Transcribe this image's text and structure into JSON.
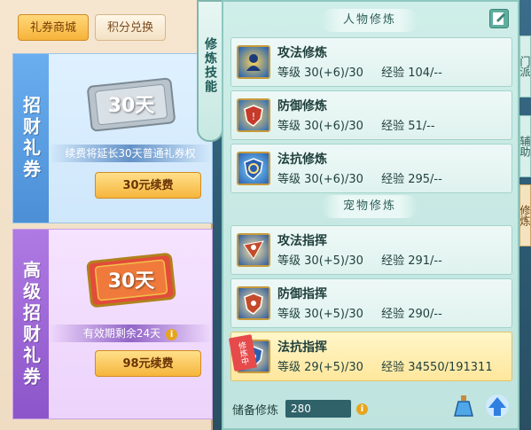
{
  "shop": {
    "tabs": [
      {
        "label": "礼券商城",
        "active": true
      },
      {
        "label": "积分兑换",
        "active": false
      }
    ],
    "basic_card": {
      "side_title": "招财礼券",
      "ticket_text": "30天",
      "note": "续费将延长30天普通礼券权",
      "button": "30元续费"
    },
    "premium_card": {
      "side_title": "高级招财礼券",
      "ticket_text": "30天",
      "note": "有效期剩余24天",
      "info": "i",
      "button": "98元续费"
    }
  },
  "skill_tab": {
    "label": "修炼技能"
  },
  "cultivation": {
    "character_section": "人物修炼",
    "pet_section": "宠物修炼",
    "level_label": "等级",
    "exp_label": "经验",
    "character_skills": [
      {
        "name": "攻法修炼",
        "level": "30(+6)/30",
        "exp": "104/--",
        "icon": "attack-magic-icon"
      },
      {
        "name": "防御修炼",
        "level": "30(+6)/30",
        "exp": "51/--",
        "icon": "defense-icon"
      },
      {
        "name": "法抗修炼",
        "level": "30(+6)/30",
        "exp": "295/--",
        "icon": "magic-resist-icon"
      }
    ],
    "pet_skills": [
      {
        "name": "攻法指挥",
        "level": "30(+5)/30",
        "exp": "291/--",
        "icon": "pet-attack-icon"
      },
      {
        "name": "防御指挥",
        "level": "30(+5)/30",
        "exp": "290/--",
        "icon": "pet-defense-icon"
      },
      {
        "name": "法抗指挥",
        "level": "29(+5)/30",
        "exp": "34550/191311",
        "icon": "pet-resist-icon",
        "badge": "修炼中",
        "active": true
      }
    ],
    "reserve": {
      "label": "储备修炼",
      "value": "280",
      "info": "i"
    }
  },
  "edge_tabs": [
    "门派",
    "辅助",
    "修炼"
  ],
  "colors": {
    "accent_gold": "#f6b53c",
    "panel_teal": "#cfeee9",
    "active_row": "#ffe79c",
    "basic_side": "#4c8fd6",
    "premium_side": "#8c55c9"
  }
}
